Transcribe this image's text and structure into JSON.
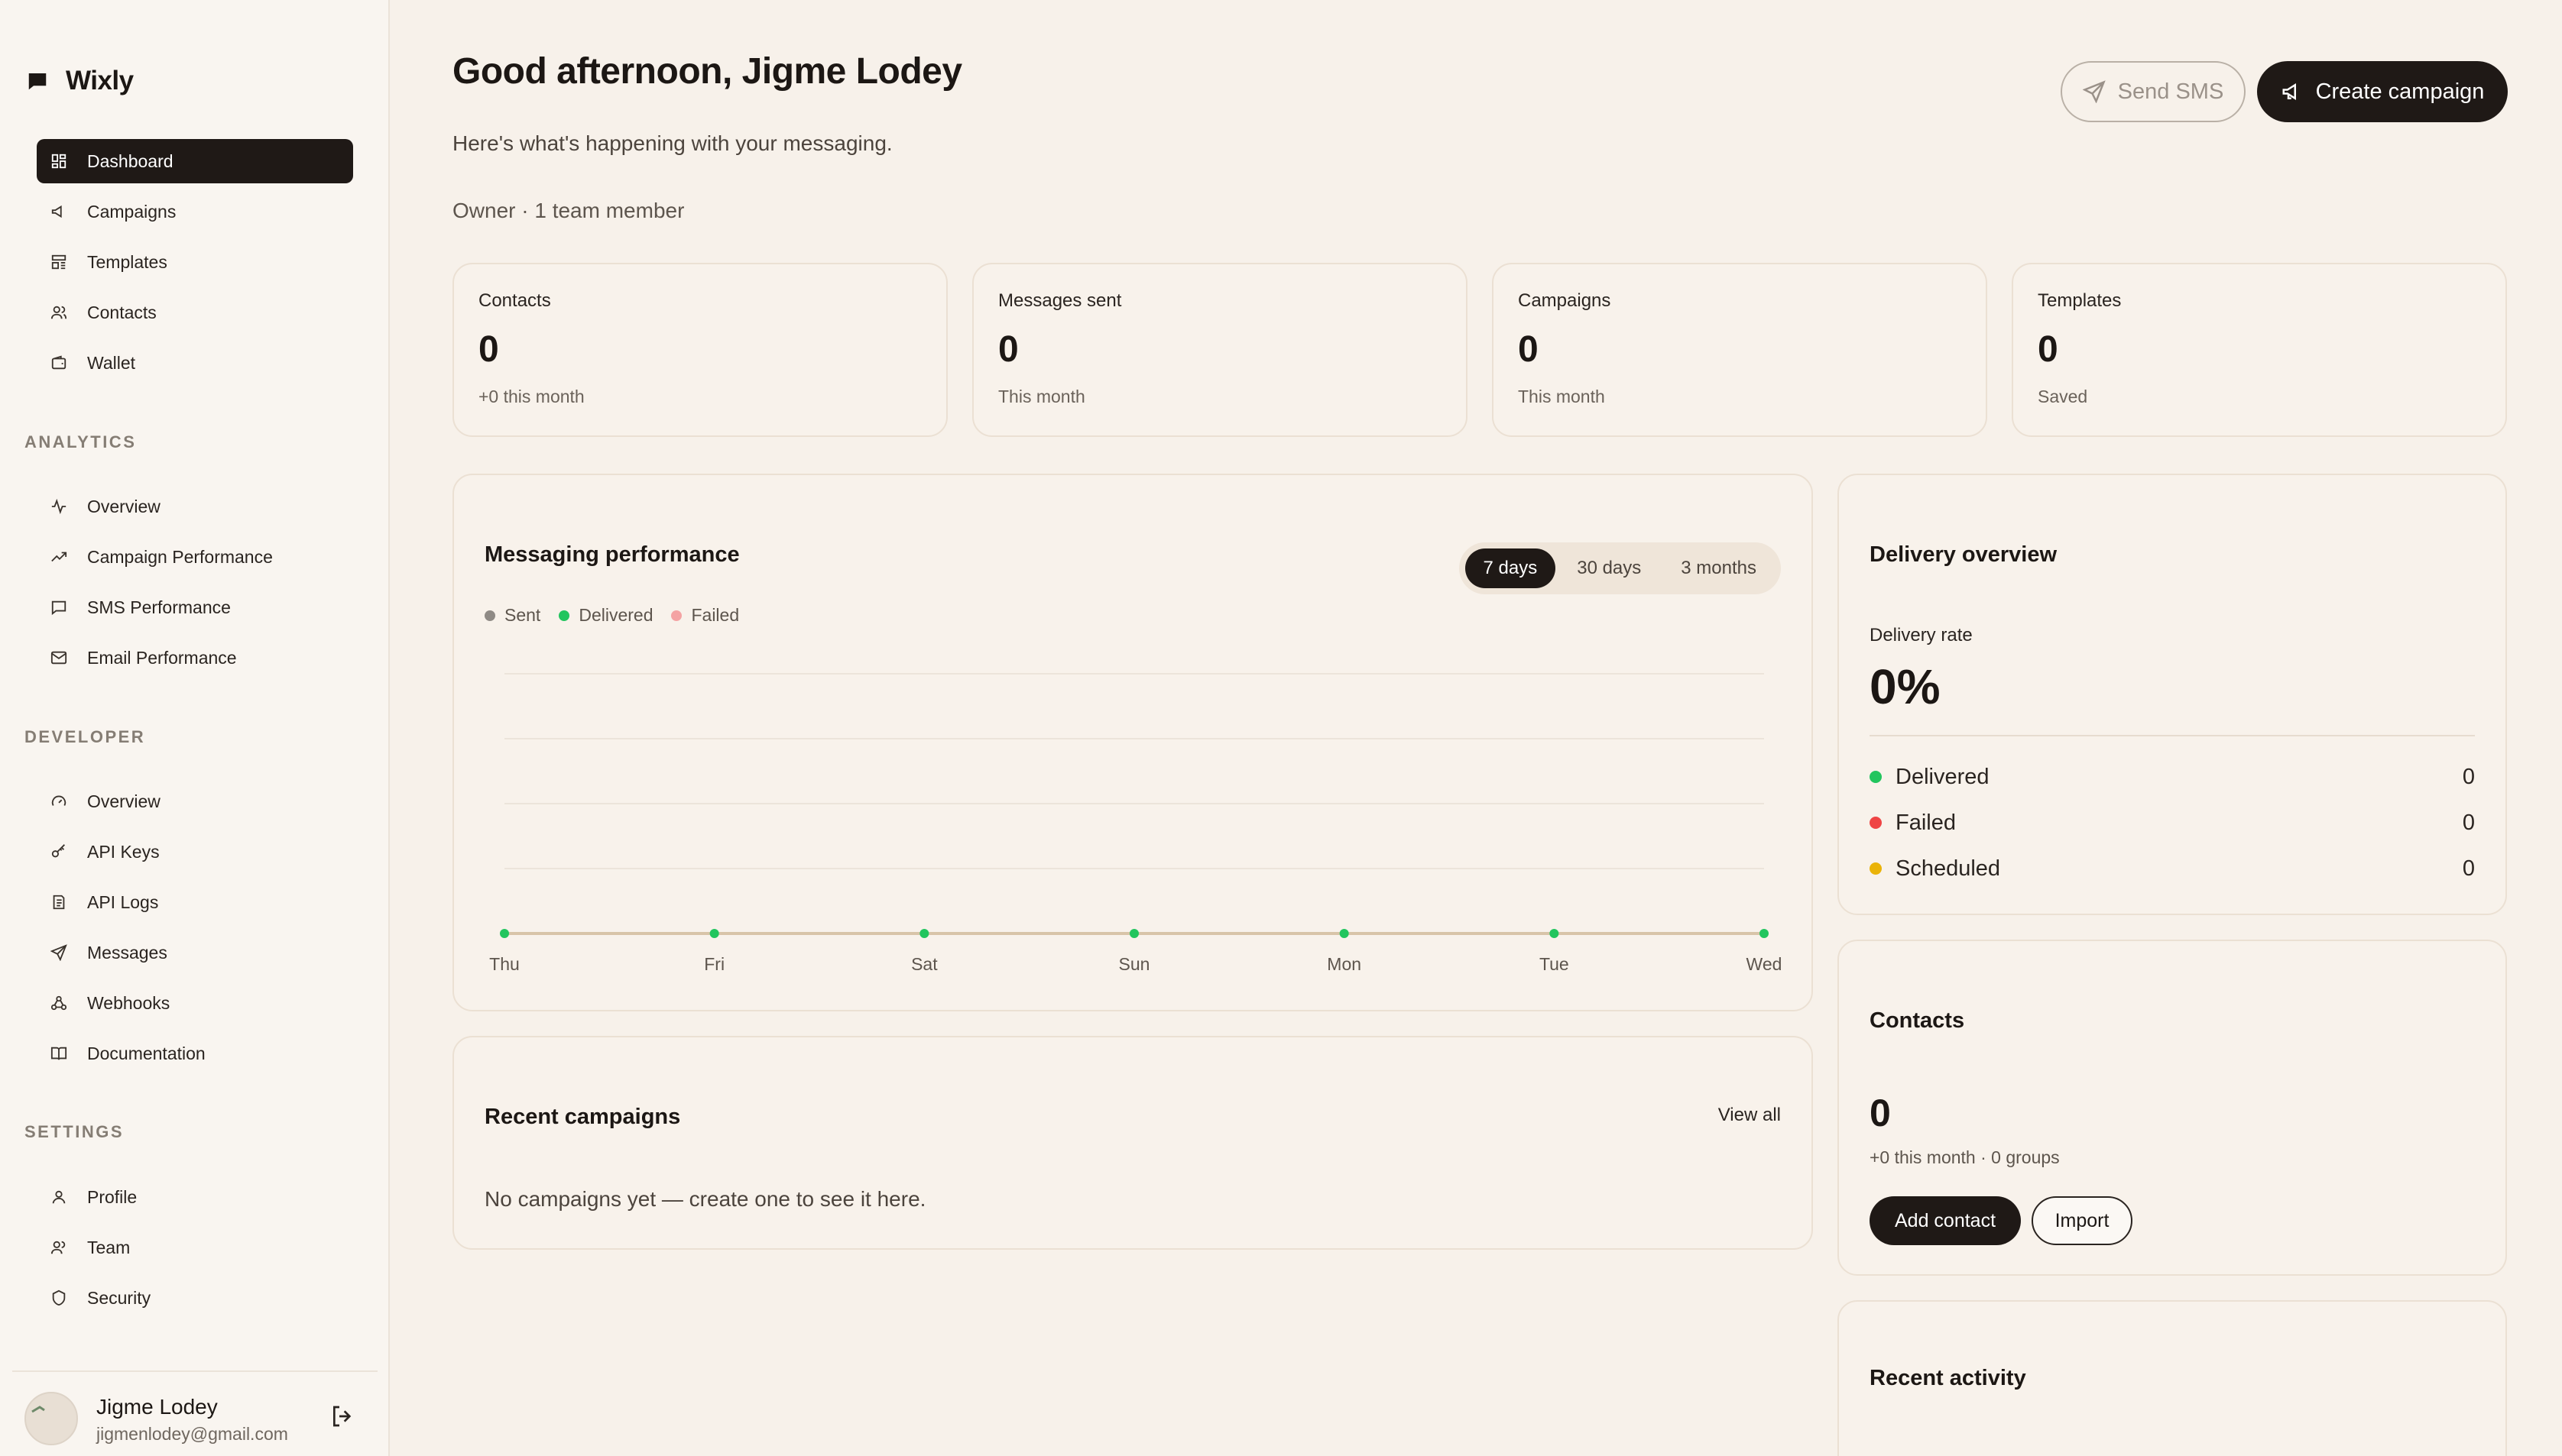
{
  "app": {
    "name": "Wixly"
  },
  "sidebar": {
    "main_items": [
      {
        "label": "Dashboard",
        "icon": "dashboard-icon"
      },
      {
        "label": "Campaigns",
        "icon": "megaphone-icon"
      },
      {
        "label": "Templates",
        "icon": "template-icon"
      },
      {
        "label": "Contacts",
        "icon": "users-icon"
      },
      {
        "label": "Wallet",
        "icon": "wallet-icon"
      }
    ],
    "analytics_label": "ANALYTICS",
    "analytics_items": [
      {
        "label": "Overview",
        "icon": "activity-icon"
      },
      {
        "label": "Campaign Performance",
        "icon": "trending-up-icon"
      },
      {
        "label": "SMS Performance",
        "icon": "message-square-icon"
      },
      {
        "label": "Email Performance",
        "icon": "mail-icon"
      }
    ],
    "developer_label": "DEVELOPER",
    "developer_items": [
      {
        "label": "Overview",
        "icon": "gauge-icon"
      },
      {
        "label": "API Keys",
        "icon": "key-icon"
      },
      {
        "label": "API Logs",
        "icon": "logs-icon"
      },
      {
        "label": "Messages",
        "icon": "send-icon"
      },
      {
        "label": "Webhooks",
        "icon": "webhook-icon"
      },
      {
        "label": "Documentation",
        "icon": "book-icon"
      }
    ],
    "settings_label": "SETTINGS",
    "settings_items": [
      {
        "label": "Profile",
        "icon": "user-icon"
      },
      {
        "label": "Team",
        "icon": "team-icon"
      },
      {
        "label": "Security",
        "icon": "shield-icon"
      }
    ],
    "user": {
      "name": "Jigme Lodey",
      "email": "jigmenlodey@gmail.com"
    }
  },
  "header": {
    "greeting": "Good afternoon, Jigme Lodey",
    "subtitle": "Here's what's happening with your messaging.",
    "meta": "Owner  ·  1 team member",
    "send_sms": "Send SMS",
    "create_campaign": "Create campaign"
  },
  "stats": [
    {
      "label": "Contacts",
      "value": "0",
      "sub": "+0 this month"
    },
    {
      "label": "Messages sent",
      "value": "0",
      "sub": "This month"
    },
    {
      "label": "Campaigns",
      "value": "0",
      "sub": "This month"
    },
    {
      "label": "Templates",
      "value": "0",
      "sub": "Saved"
    }
  ],
  "performance": {
    "title": "Messaging performance",
    "ranges": [
      "7 days",
      "30 days",
      "3 months"
    ],
    "active_range": "7 days"
  },
  "chart_data": {
    "type": "line",
    "categories": [
      "Thu",
      "Fri",
      "Sat",
      "Sun",
      "Mon",
      "Tue",
      "Wed"
    ],
    "series": [
      {
        "name": "Sent",
        "color": "#8f8a85",
        "values": [
          0,
          0,
          0,
          0,
          0,
          0,
          0
        ]
      },
      {
        "name": "Delivered",
        "color": "#22c55e",
        "values": [
          0,
          0,
          0,
          0,
          0,
          0,
          0
        ]
      },
      {
        "name": "Failed",
        "color": "#f4a3a3",
        "values": [
          0,
          0,
          0,
          0,
          0,
          0,
          0
        ]
      }
    ],
    "title": "Messaging performance",
    "xlabel": "",
    "ylabel": "",
    "ylim": [
      0,
      4
    ],
    "grid": true,
    "legend": "top-left"
  },
  "recent_campaigns": {
    "title": "Recent campaigns",
    "view_all": "View all",
    "empty": "No campaigns yet — create one to see it here."
  },
  "delivery": {
    "title": "Delivery overview",
    "rate_label": "Delivery rate",
    "rate_value": "0%",
    "rows": [
      {
        "label": "Delivered",
        "value": "0",
        "color": "#22c55e"
      },
      {
        "label": "Failed",
        "value": "0",
        "color": "#ef4444"
      },
      {
        "label": "Scheduled",
        "value": "0",
        "color": "#eab308"
      }
    ]
  },
  "contacts_card": {
    "title": "Contacts",
    "value": "0",
    "sub": "+0 this month · 0 groups",
    "add": "Add contact",
    "import": "Import"
  },
  "activity": {
    "title": "Recent activity"
  }
}
